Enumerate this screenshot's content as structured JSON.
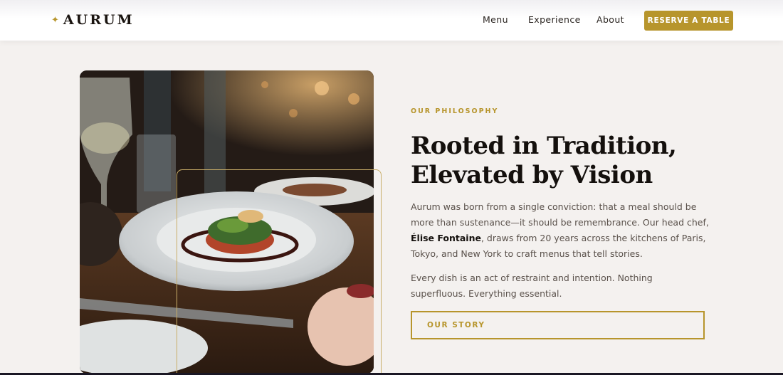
{
  "header": {
    "logo_text": "AURUM",
    "logo_icon": "sparkle-star-icon",
    "nav": [
      "Menu",
      "Experience",
      "About"
    ],
    "cta": "RESERVE A TABLE"
  },
  "hero_image": {
    "subject": "plated-dish-photo"
  },
  "philosophy": {
    "eyebrow": "OUR PHILOSOPHY",
    "title_line1": "Rooted in Tradition,",
    "title_line2": "Elevated by Vision",
    "p1_before": "Aurum was born from a single conviction: that a meal should be more than sustenance—it should be remembrance. Our head chef, ",
    "p1_chef": "Élise Fontaine",
    "p1_after": ", draws from 20 years across the kitchens of Paris, Tokyo, and New York to craft menus that tell stories.",
    "p2": "Every dish is an act of restraint and intention. Nothing superfluous. Everything essential.",
    "button": "OUR STORY"
  },
  "colors": {
    "accent_gold": "#b7952c",
    "background": "#f4f1ef",
    "heading": "#14100d",
    "body_text": "#5a514b"
  }
}
